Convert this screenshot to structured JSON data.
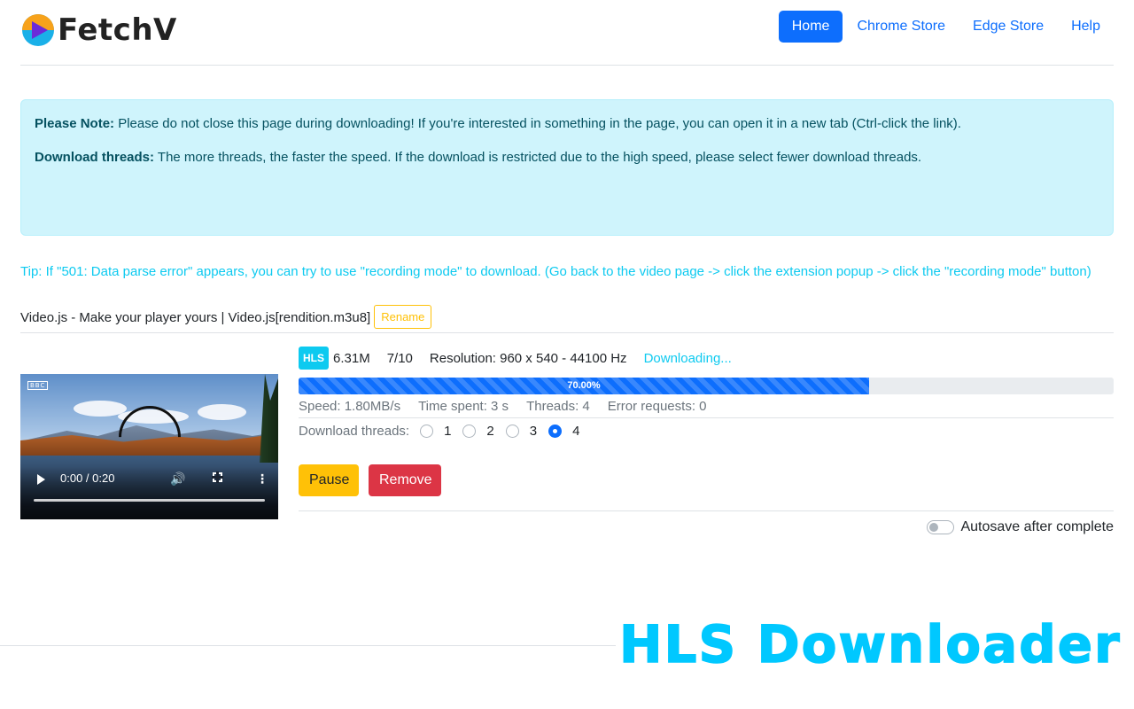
{
  "brand": {
    "name": "FetchV"
  },
  "nav": [
    {
      "label": "Home",
      "active": true
    },
    {
      "label": "Chrome Store",
      "active": false
    },
    {
      "label": "Edge Store",
      "active": false
    },
    {
      "label": "Help",
      "active": false
    }
  ],
  "alert": {
    "note_label": "Please Note:",
    "note_text": " Please do not close this page during downloading! If you're interested in something in the page, you can open it in a new tab (Ctrl-click the link).",
    "threads_label": "Download threads:",
    "threads_text": " The more threads, the faster the speed. If the download is restricted due to the high speed, please select fewer download threads."
  },
  "tip": "Tip: If \"501: Data parse error\" appears, you can try to use \"recording mode\" to download. (Go back to the video page -> click the extension popup -> click the \"recording mode\" button)",
  "video_item": {
    "title": "Video.js - Make your player yours | Video.js[rendition.m3u8]",
    "rename_label": "Rename",
    "player": {
      "time": "0:00 / 0:20",
      "watermark": "BBC"
    },
    "badge": "HLS",
    "size": "6.31M",
    "segments": "7/10",
    "resolution": "Resolution: 960 x 540 - 44100 Hz",
    "status": "Downloading...",
    "progress": {
      "percent": 70,
      "label": "70.00%"
    },
    "stats": {
      "speed": "Speed: 1.80MB/s",
      "time_spent": "Time spent: 3 s",
      "threads": "Threads: 4",
      "errors": "Error requests: 0"
    },
    "thread_options": {
      "label": "Download threads:",
      "options": [
        "1",
        "2",
        "3",
        "4"
      ],
      "selected": "4"
    },
    "pause_label": "Pause",
    "remove_label": "Remove",
    "autosave_label": "Autosave after complete",
    "autosave_on": false
  },
  "promo": "HLS Downloader",
  "colors": {
    "primary": "#0d6efd",
    "info": "#0dcaf0",
    "warning": "#ffc107",
    "danger": "#dc3545",
    "alert_bg": "#cff4fc",
    "promo": "#00c8ff"
  }
}
